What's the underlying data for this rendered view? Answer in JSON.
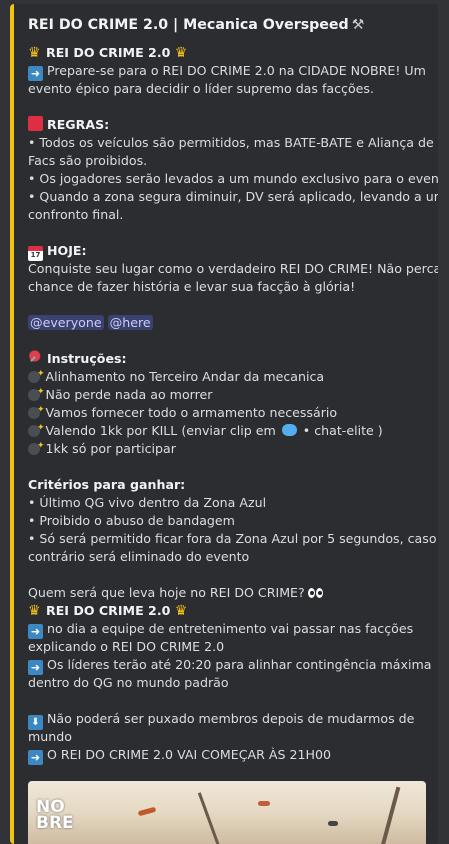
{
  "embed": {
    "accent_color": "#f1c40f",
    "title": "REI DO CRIME 2.0 | Mecanica Overspeed",
    "title_icon": "hammer-wrench-icon",
    "header": "REI DO CRIME 2.0",
    "intro_line1": "Prepare-se para o REI DO CRIME 2.0 na CIDADE NOBRE! Um",
    "intro_line2": "evento épico para decidir o líder supremo das facções.",
    "rules_heading": "REGRAS:",
    "rules": [
      "• Todos os veículos são permitidos, mas BATE-BATE e Aliança de",
      "Facs são proibidos.",
      "• Os jogadores serão levados a um mundo exclusivo para o evento.",
      "• Quando a zona segura diminuir, DV será aplicado, levando a um",
      "confronto final."
    ],
    "calendar_day": "17",
    "today_heading": "HOJE:",
    "today_line1": "Conquiste seu lugar como o verdadeiro REI DO CRIME! Não perca a",
    "today_line2": "chance de fazer história e levar sua facção à glória!",
    "mention_everyone": "@everyone",
    "mention_here": "@here",
    "instructions_heading": "Instruções:",
    "instructions": [
      "Alinhamento no Terceiro Andar da mecanica",
      "Não perde nada ao morrer",
      "Vamos fornecer todo o armamento necessário",
      "Valendo 1kk por KILL (enviar clip em",
      "1kk só por participar"
    ],
    "channel_mention": "• chat-elite )",
    "criteria_heading": "Critérios para ganhar:",
    "criteria": [
      "• Último QG vivo dentro da Zona Azul",
      "• Proibido o abuso de bandagem",
      "• Só será permitido ficar fora da Zona Azul por 5 segundos, caso",
      "contrário será eliminado do evento"
    ],
    "question": "Quem será que leva hoje no REI DO CRIME?",
    "header2": "REI DO CRIME 2.0",
    "announce1_line1": "no dia a equipe de entretenimento vai passar nas facções",
    "announce1_line2": "explicando o REI DO CRIME 2.0",
    "announce2_line1": "Os líderes terão até 20:20 para alinhar contingência máxima",
    "announce2_line2": "dentro do QG no mundo padrão",
    "down_line1": "Não poderá ser puxado membros depois de mudarmos de",
    "down_line2": "mundo",
    "final": "O REI DO CRIME 2.0 VAI COMEÇAR ÀS 21H00",
    "image_logo_line1": "NO",
    "image_logo_line2": "BRE"
  }
}
